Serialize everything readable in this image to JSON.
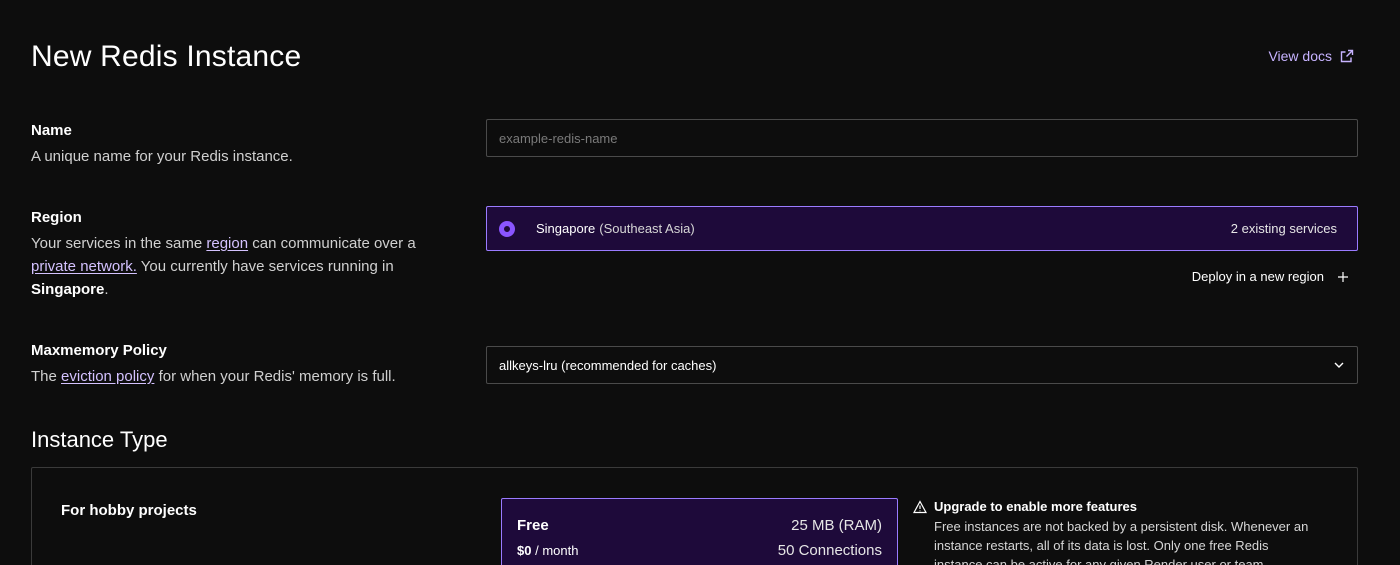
{
  "header": {
    "title": "New Redis Instance",
    "view_docs": "View docs"
  },
  "name_field": {
    "label": "Name",
    "description": "A unique name for your Redis instance.",
    "placeholder": "example-redis-name",
    "value": ""
  },
  "region": {
    "label": "Region",
    "desc_part1": "Your services in the same ",
    "desc_link1": "region",
    "desc_part2": " can communicate over a ",
    "desc_link2": "private network.",
    "desc_part3": " You currently have services running in ",
    "desc_bold": "Singapore",
    "desc_part4": ".",
    "selected_name": "Singapore",
    "selected_sub": "(Southeast Asia)",
    "existing_count": "2 existing services",
    "deploy_new": "Deploy in a new region",
    "deploy_icon": "plus-icon"
  },
  "maxmemory": {
    "label": "Maxmemory Policy",
    "desc_part1": "The ",
    "desc_link": "eviction policy",
    "desc_part2": " for when your Redis' memory is full.",
    "selected": "allkeys-lru (recommended for caches)"
  },
  "instance_type": {
    "title": "Instance Type",
    "group_label": "For hobby projects",
    "plan": {
      "name": "Free",
      "ram": "25 MB (RAM)",
      "price": "$0",
      "period": "/ month",
      "connections": "50 Connections"
    },
    "upgrade": {
      "title": "Upgrade to enable more features",
      "body": "Free instances are not backed by a persistent disk. Whenever an instance restarts, all of its data is lost. Only one free Redis instance can be active for any given Render user or team."
    }
  },
  "colors": {
    "background": "#0d0d0d",
    "accent": "#8a55ff",
    "selected_bg": "#1e0a3a",
    "link": "#d4c2ff"
  }
}
